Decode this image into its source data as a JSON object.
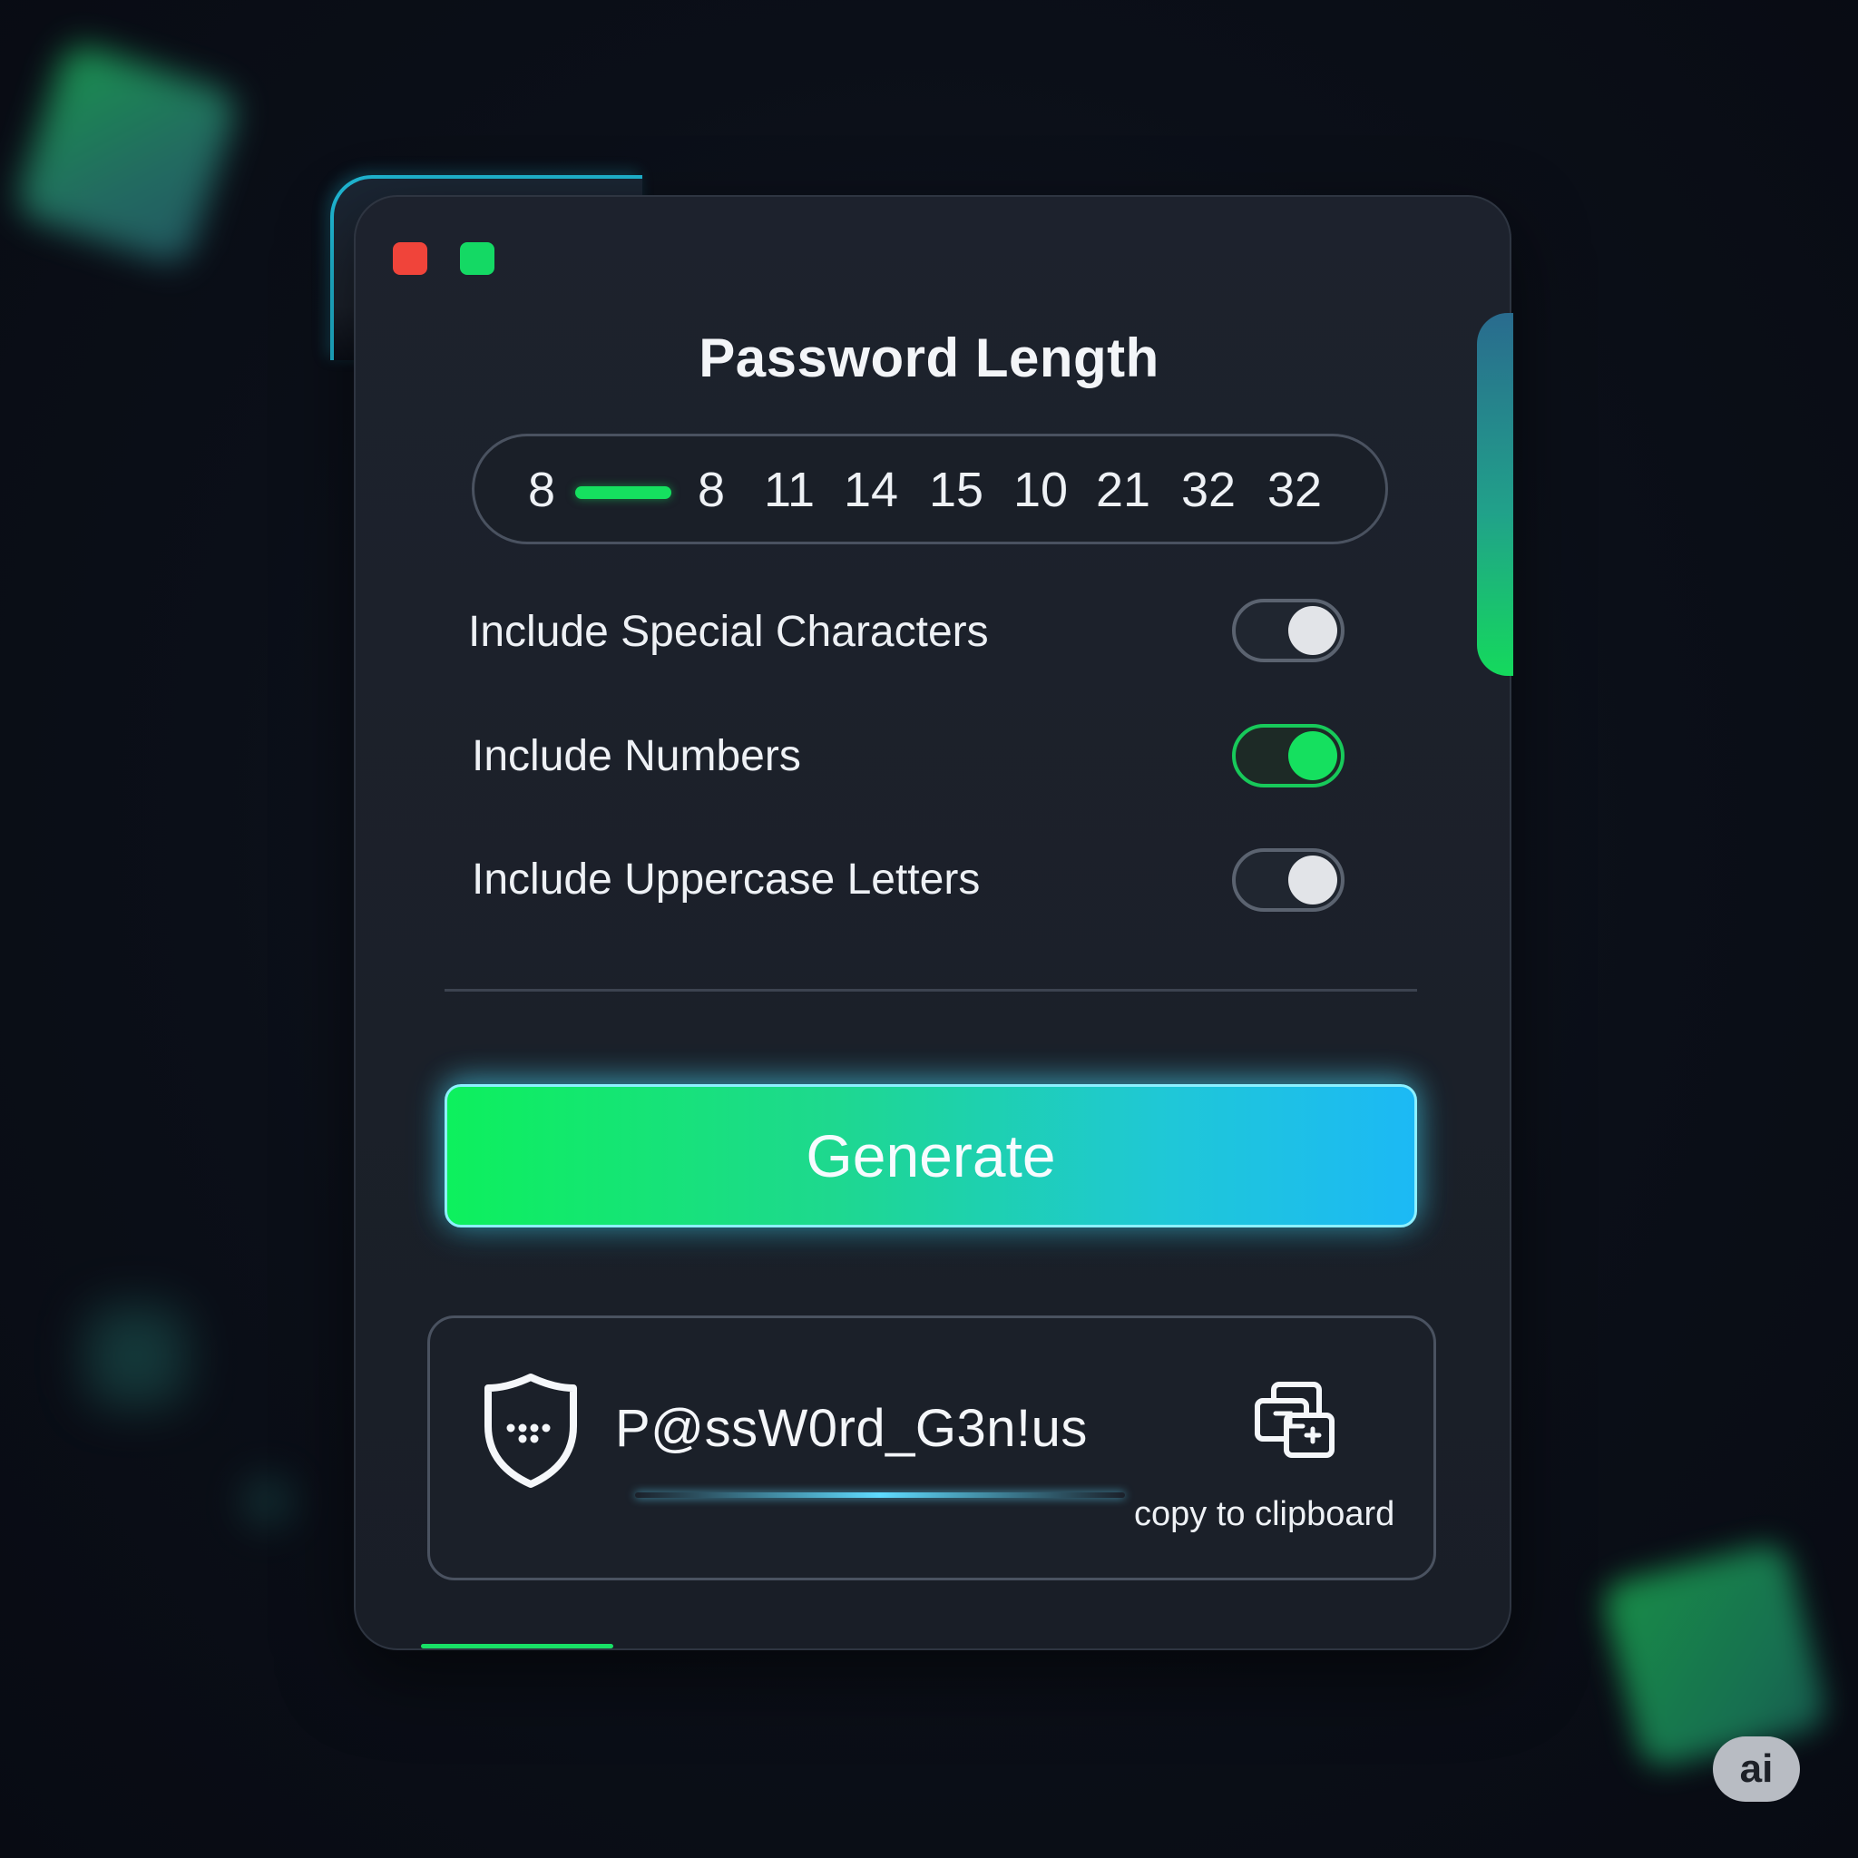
{
  "window": {
    "controls": [
      {
        "name": "close",
        "color": "#f0443a"
      },
      {
        "name": "maximize",
        "color": "#14d964"
      }
    ]
  },
  "length": {
    "title": "Password Length",
    "slider_min_label": "8",
    "options": [
      "8",
      "11",
      "14",
      "15",
      "10",
      "21",
      "32",
      "32"
    ],
    "accent_color": "#15e05f"
  },
  "options": [
    {
      "label": "Include Special Characters",
      "enabled": false
    },
    {
      "label": "Include Numbers",
      "enabled": true
    },
    {
      "label": "Include Uppercase Letters",
      "enabled": false
    }
  ],
  "actions": {
    "generate_label": "Generate"
  },
  "result": {
    "icon": "shield-icon",
    "password": "P@ssW0rd_G3n!us",
    "copy_icon": "copy-icon",
    "copy_label": "copy to clipboard"
  },
  "badge": {
    "label": "ai"
  },
  "colors": {
    "background": "#0a0e17",
    "panel": "#1d222d",
    "accent_green": "#15e05f",
    "accent_cyan": "#1cb9f5"
  }
}
